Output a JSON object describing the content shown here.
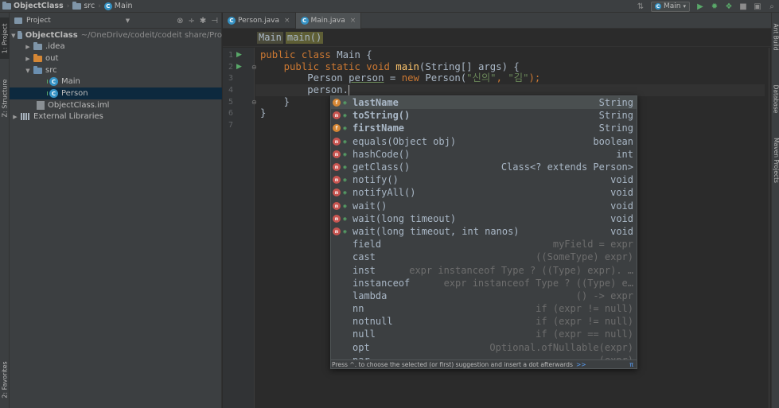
{
  "navbar": {
    "project": "ObjectClass",
    "src": "src",
    "main": "Main",
    "run_config": "Main"
  },
  "left_strip": {
    "project_tab": "1: Project",
    "structure_tab": "Z: Structure",
    "favorites_tab": "2: Favorites"
  },
  "right_strip": {
    "ant_tab": "Ant Build",
    "database_tab": "Database",
    "maven_tab": "Maven Projects"
  },
  "project_panel": {
    "title": "Project",
    "tree": [
      {
        "label": "ObjectClass",
        "path": "~/OneDrive/codeit/codeit share/Pro"
      },
      {
        "label": ".idea"
      },
      {
        "label": "out"
      },
      {
        "label": "src"
      },
      {
        "label": "Main"
      },
      {
        "label": "Person"
      },
      {
        "label": "ObjectClass.iml"
      },
      {
        "label": "External Libraries"
      }
    ]
  },
  "editor": {
    "tabs": [
      {
        "label": "Person.java"
      },
      {
        "label": "Main.java"
      }
    ],
    "breadcrumbs": [
      "Main",
      "main()"
    ],
    "line_numbers": [
      "1",
      "2",
      "3",
      "4",
      "5",
      "6",
      "7"
    ],
    "code": {
      "l1_kw": "public class ",
      "l1_name": "Main {",
      "l2_kw": "public static void ",
      "l2_fn": "main",
      "l2_rest": "(String[] args) {",
      "l3_type": "Person ",
      "l3_var": "person",
      "l3_eq": " = ",
      "l3_new": "new ",
      "l3_call": "Person(",
      "l3_s1": "\"신의\"",
      "l3_comma": ", ",
      "l3_s2": "\"김\"",
      "l3_end": ");",
      "l4": "person.",
      "l5": "}",
      "l6": "}"
    }
  },
  "completion": {
    "items": [
      {
        "name": "lastName",
        "type": "String",
        "icon": "field"
      },
      {
        "name": "toString()",
        "type": "String",
        "icon": "method"
      },
      {
        "name": "firstName",
        "type": "String",
        "icon": "field"
      },
      {
        "name": "equals(Object obj)",
        "type": "boolean",
        "icon": "method"
      },
      {
        "name": "hashCode()",
        "type": "int",
        "icon": "method"
      },
      {
        "name": "getClass()",
        "type": "Class<? extends Person>",
        "icon": "method"
      },
      {
        "name": "notify()",
        "type": "void",
        "icon": "method"
      },
      {
        "name": "notifyAll()",
        "type": "void",
        "icon": "method"
      },
      {
        "name": "wait()",
        "type": "void",
        "icon": "method"
      },
      {
        "name": "wait(long timeout)",
        "type": "void",
        "icon": "method"
      },
      {
        "name": "wait(long timeout, int nanos)",
        "type": "void",
        "icon": "method"
      }
    ],
    "templates": [
      {
        "name": "field",
        "desc": "myField = expr"
      },
      {
        "name": "cast",
        "desc": "((SomeType) expr)"
      },
      {
        "name": "inst",
        "desc": "expr instanceof Type ? ((Type) expr). …"
      },
      {
        "name": "instanceof",
        "desc": "expr instanceof Type ? ((Type) e…"
      },
      {
        "name": "lambda",
        "desc": "() -> expr"
      },
      {
        "name": "nn",
        "desc": "if (expr != null)"
      },
      {
        "name": "notnull",
        "desc": "if (expr != null)"
      },
      {
        "name": "null",
        "desc": "if (expr == null)"
      },
      {
        "name": "opt",
        "desc": "Optional.ofNullable(expr)"
      },
      {
        "name": "par",
        "desc": "(expr)"
      }
    ],
    "footer": "Press ^. to choose the selected (or first) suggestion and insert a dot afterwards",
    "footer_link": ">>",
    "footer_pi": "π"
  },
  "colors": {
    "keyword": "#cc7832",
    "function": "#ffc66d",
    "string": "#6a8759",
    "field_icon": "#d58735",
    "method_icon": "#c75450",
    "class_icon": "#3592c4"
  }
}
